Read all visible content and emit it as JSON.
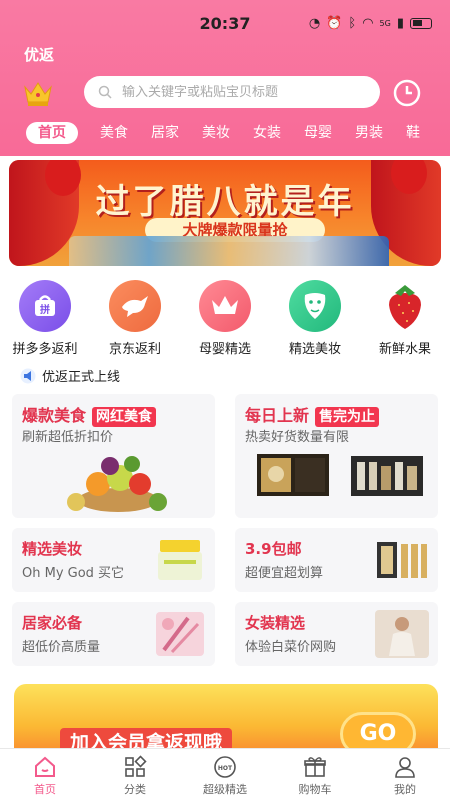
{
  "status_bar": {
    "time": "20:37",
    "network": "5G"
  },
  "app": {
    "name": "优返"
  },
  "search": {
    "placeholder": "输入关键字或粘贴宝贝标题"
  },
  "tabs": [
    {
      "label": "首页",
      "active": true
    },
    {
      "label": "美食"
    },
    {
      "label": "居家"
    },
    {
      "label": "美妆"
    },
    {
      "label": "女装"
    },
    {
      "label": "母婴"
    },
    {
      "label": "男装"
    },
    {
      "label": "鞋"
    }
  ],
  "banner": {
    "title": "过了腊八就是年",
    "subtitle": "大牌爆款限量抢"
  },
  "categories": [
    {
      "label": "拼多多返利",
      "icon": "pinduoduo-icon",
      "color": "#8a5cf6"
    },
    {
      "label": "京东返利",
      "icon": "jd-dog-icon",
      "color": "#f27a4b"
    },
    {
      "label": "母婴精选",
      "icon": "crown-icon",
      "color": "#f76a7d"
    },
    {
      "label": "精选美妆",
      "icon": "face-mask-icon",
      "color": "#33c98e"
    },
    {
      "label": "新鲜水果",
      "icon": "strawberry-icon",
      "color": "#e2302f"
    }
  ],
  "notice": {
    "text": "优返正式上线"
  },
  "cards_large": [
    {
      "title": "爆款美食",
      "tag": "网红美食",
      "subtitle": "刷新超低折扣价"
    },
    {
      "title": "每日上新",
      "tag": "售完为止",
      "subtitle": "热卖好货数量有限"
    }
  ],
  "cards_small": [
    {
      "title": "精选美妆",
      "subtitle": "Oh My God 买它"
    },
    {
      "title": "3.9包邮",
      "subtitle": "超便宜超划算"
    },
    {
      "title": "居家必备",
      "subtitle": "超低价高质量"
    },
    {
      "title": "女装精选",
      "subtitle": "体验白菜价网购"
    }
  ],
  "member_banner": {
    "text": "加入会员拿返现哦",
    "go": "GO"
  },
  "bottom_nav": [
    {
      "label": "首页",
      "active": true
    },
    {
      "label": "分类"
    },
    {
      "label": "超级精选"
    },
    {
      "label": "购物车"
    },
    {
      "label": "我的"
    }
  ],
  "colors": {
    "primary": "#f86a97",
    "accent_red": "#e2354f",
    "tag_red": "#f2364f"
  }
}
